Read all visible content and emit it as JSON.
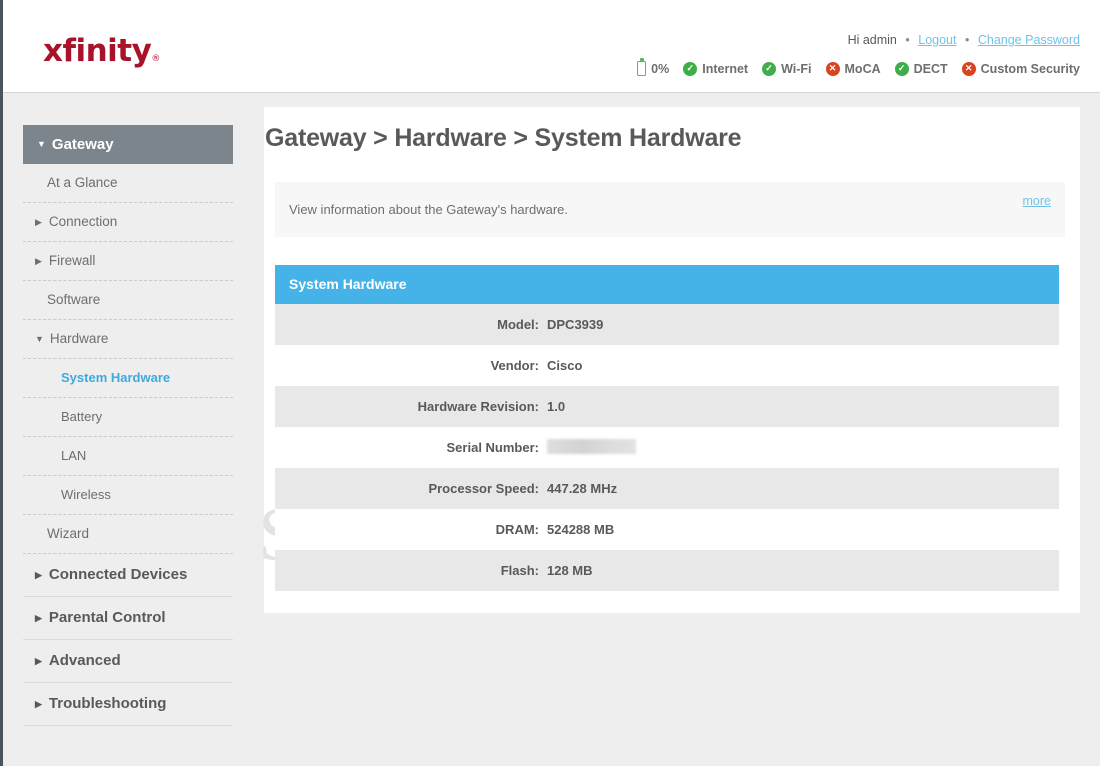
{
  "header": {
    "logo_text": "xfinity",
    "logo_tm": "®",
    "greeting": "Hi admin",
    "separator": "•",
    "logout_label": "Logout",
    "change_password_label": "Change Password",
    "brand_color": "#a8132a",
    "link_color": "#6fc3e8"
  },
  "status": {
    "battery": {
      "icon": "battery-icon",
      "label": "0%",
      "color": "#5cb85c"
    },
    "items": [
      {
        "icon": "check-circle-icon",
        "label": "Internet",
        "state": "ok",
        "color": "#3fae49"
      },
      {
        "icon": "check-circle-icon",
        "label": "Wi-Fi",
        "state": "ok",
        "color": "#3fae49"
      },
      {
        "icon": "x-circle-icon",
        "label": "MoCA",
        "state": "error",
        "color": "#d9431f"
      },
      {
        "icon": "check-circle-icon",
        "label": "DECT",
        "state": "ok",
        "color": "#3fae49"
      },
      {
        "icon": "x-circle-icon",
        "label": "Custom Security",
        "state": "error",
        "color": "#d9431f"
      }
    ]
  },
  "sidebar": {
    "top": {
      "label": "Gateway",
      "icon": "chevron-down-icon",
      "bg_color": "#7d858c"
    },
    "items": [
      {
        "label": "At a Glance",
        "level": 1,
        "icon": "",
        "active": false
      },
      {
        "label": "Connection",
        "level": 1,
        "icon": "chevron-right-icon",
        "active": false
      },
      {
        "label": "Firewall",
        "level": 1,
        "icon": "chevron-right-icon",
        "active": false
      },
      {
        "label": "Software",
        "level": 1,
        "icon": "",
        "active": false
      },
      {
        "label": "Hardware",
        "level": 1,
        "icon": "chevron-down-icon",
        "active": false
      },
      {
        "label": "System Hardware",
        "level": 2,
        "icon": "",
        "active": true
      },
      {
        "label": "Battery",
        "level": 2,
        "icon": "",
        "active": false
      },
      {
        "label": "LAN",
        "level": 2,
        "icon": "",
        "active": false
      },
      {
        "label": "Wireless",
        "level": 2,
        "icon": "",
        "active": false
      },
      {
        "label": "Wizard",
        "level": 1,
        "icon": "",
        "active": false
      }
    ],
    "major_items": [
      {
        "label": "Connected Devices",
        "icon": "chevron-right-icon"
      },
      {
        "label": "Parental Control",
        "icon": "chevron-right-icon"
      },
      {
        "label": "Advanced",
        "icon": "chevron-right-icon"
      },
      {
        "label": "Troubleshooting",
        "icon": "chevron-right-icon"
      }
    ],
    "active_color": "#3fa9dd"
  },
  "main": {
    "page_title": "Gateway > Hardware > System Hardware",
    "description": "View information about the Gateway's hardware.",
    "more_label": "more",
    "panel_title": "System Hardware",
    "panel_color": "#45b2e8",
    "rows": [
      {
        "key": "Model:",
        "value": "DPC3939",
        "redacted": false
      },
      {
        "key": "Vendor:",
        "value": "Cisco",
        "redacted": false
      },
      {
        "key": "Hardware Revision:",
        "value": "1.0",
        "redacted": false
      },
      {
        "key": "Serial Number:",
        "value": "",
        "redacted": true
      },
      {
        "key": "Processor Speed:",
        "value": "447.28 MHz",
        "redacted": false
      },
      {
        "key": "DRAM:",
        "value": "524288 MB",
        "redacted": false
      },
      {
        "key": "Flash:",
        "value": "128 MB",
        "redacted": false
      }
    ]
  },
  "watermark": {
    "text": "SetupRouter.com"
  }
}
